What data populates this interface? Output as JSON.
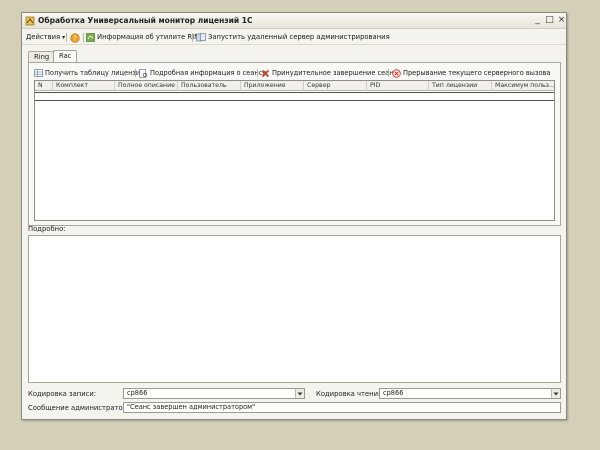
{
  "window": {
    "title": "Обработка  Универсальный монитор лицензий 1С",
    "controls": {
      "minimize": "_",
      "maximize": "□",
      "close": "×"
    }
  },
  "toolbar": {
    "actions": "Действия",
    "help_icon": "help-icon",
    "info_ring": "Информация об утилите RING",
    "start_server": "Запустить удаленный сервер администрирования"
  },
  "tabs": [
    {
      "label": "Ring",
      "active": false
    },
    {
      "label": "Rac",
      "active": true
    }
  ],
  "rac_panel": {
    "buttons": {
      "get_table": "Получить таблицу лицензий",
      "session_info": "Подробная информация о сеансе",
      "terminate_session": "Принудительное завершение сеанса",
      "interrupt_call": "Прерывание текущего серверного вызова"
    },
    "columns": [
      "N",
      "Комплект",
      "Полное описание",
      "Пользователь",
      "Приложение",
      "Сервер",
      "PID",
      "Тип лицензии",
      "Максимум польз..."
    ]
  },
  "details": {
    "label": "Подробно:"
  },
  "encoding": {
    "write_label": "Кодировка записи:",
    "write_value": "cp866",
    "read_label": "Кодировка чтения:",
    "read_value": "cp866"
  },
  "admin_message": {
    "label": "Сообщение администратора:",
    "value": "\"Сеанс завершен администратором\""
  },
  "colors": {
    "background": "#d4d0b8",
    "window": "#f4f3ee",
    "accent_red": "#c93a2a"
  }
}
